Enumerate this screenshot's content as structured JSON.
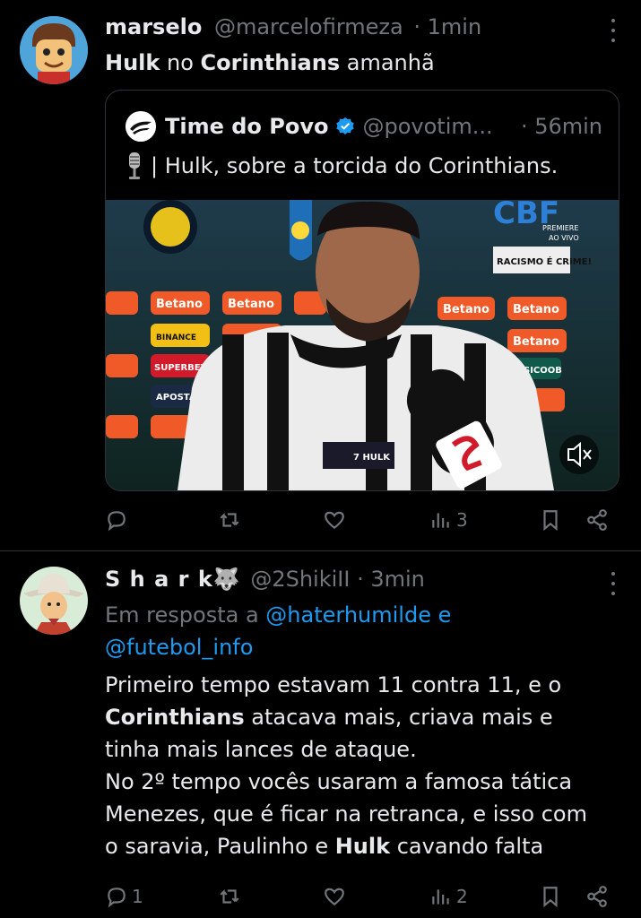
{
  "tweet1": {
    "display_name": "marselo",
    "handle": "@marcelofirmeza",
    "dot": "·",
    "time": "1min",
    "text_bold_1": "Hulk",
    "text_plain_1": " no ",
    "text_bold_2": "Corinthians",
    "text_plain_2": " amanhã",
    "quote": {
      "display_name": "Time do Povo",
      "handle": "@povotim...",
      "time": "· 56min",
      "text": "| Hulk, sobre a torcida do Corinthians.",
      "media": {
        "sponsor": "Betano",
        "sponsors": [
          "Betano",
          "SUPERBET",
          "BINANCE",
          "APOSTA",
          "SICOOB"
        ],
        "cbf": "CBF",
        "premiere": "PREMIERE",
        "ao_vivo": "AO VIVO",
        "banner": "RACISMO É CRIME!",
        "lower_third": "7 HULK"
      }
    },
    "actions": {
      "reply_count": "",
      "retweet_count": "",
      "like_count": "",
      "views_count": "3"
    }
  },
  "tweet2": {
    "display_name": "S h a r k",
    "emoji": "🐺",
    "handle": "@2ShikiII",
    "dot": "·",
    "time": "3min",
    "reply_prefix": "Em resposta a ",
    "reply_to_1": "@haterhumilde",
    "reply_joiner": " e",
    "reply_to_2": "@futebol_info",
    "line1": "Primeiro tempo estavam 11 contra 11, e o",
    "line2_bold": "Corinthians",
    "line2_rest": " atacava mais, criava mais e",
    "line3": "tinha mais lances de ataque.",
    "line4": "No 2º tempo vocês usaram a famosa tática",
    "line5": "Menezes, que é ficar na retranca, e isso com",
    "line6_pre": "o saravia, Paulinho e ",
    "line6_bold": "Hulk",
    "line6_post": " cavando falta",
    "actions": {
      "reply_count": "1",
      "retweet_count": "",
      "like_count": "",
      "views_count": "2"
    }
  },
  "colors": {
    "background": "#000000",
    "text": "#e7e9ea",
    "muted": "#71767b",
    "link": "#1d9bf0",
    "border": "#2f3336",
    "verified": "#1d9bf0"
  }
}
